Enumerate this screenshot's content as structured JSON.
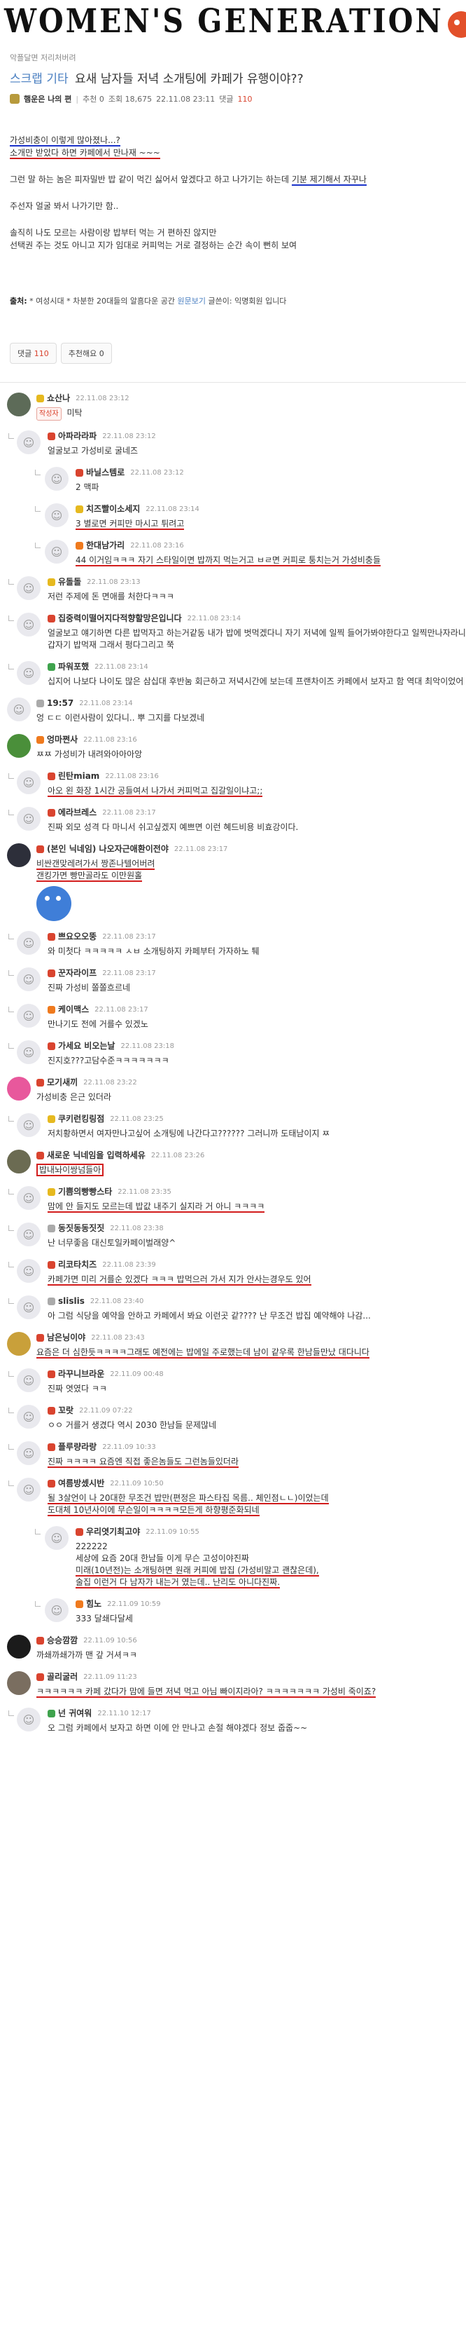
{
  "banner": {
    "title": "WOMEN'S GENERATION"
  },
  "post": {
    "board_path": "악플달면 저리처버려",
    "category": "스크랩 기타",
    "title": "요새 남자들 저녁 소개팅에 카페가 유행이야??",
    "author": "햄운은 나의 편",
    "recommend": "추천 0",
    "views": "조회 18,675",
    "datetime": "22.11.08 23:11",
    "comments_label": "댓글",
    "comments_count": "110",
    "body": {
      "line1": "가성비충이 이렇게 많아졌나...?",
      "line2": "소개만 받았다 하면 카페에서 만나재 ~~~",
      "line3a": "그런 말 하는 놈은 피자밀반 밥 같이 먹긴 싫어서 앞겠다고 하고 나가기는 하는데",
      "line3b": "기분 제기해서 자꾸나",
      "line4": "주선자 얼굴 봐서 나가기만 함..",
      "line5": "솔직히 나도 모르는 사람이랑 밥부터 먹는 거 편하진 않지만",
      "line6": "선택권 주는 것도 아니고 지가 임대로 커피먹는 거로 결정하는 순간 속이 뻔히 보여"
    },
    "source_label": "출처:",
    "source_text": "* 여성시대 * 차분한 20대들의 알흠다운 공간",
    "source_link": "원문보기",
    "source_writer": "글쓴이: 익명회원 입니다",
    "btn_comments": "댓글",
    "btn_comments_count": "110",
    "btn_recommend": "추천해요",
    "btn_recommend_count": "0"
  },
  "comments": [
    {
      "nick": "쇼산나",
      "time": "22.11.08 23:12",
      "badge": "작성자",
      "text": "미탁"
    },
    {
      "nick": "아파라라파",
      "time": "22.11.08 23:12",
      "text": "얼굴보고 가성비로 굴네즈"
    },
    {
      "nick": "바닐스템로",
      "time": "22.11.08 23:12",
      "text": "2 맥파"
    },
    {
      "nick": "치즈빨이소세지",
      "time": "22.11.08 23:14",
      "text": "3 별로면 커피만 마시고 튀려고"
    },
    {
      "nick": "한대남가리",
      "time": "22.11.08 23:16",
      "text": "44 이거임ㅋㅋㅋ 자기 스타일이면 밥까지 먹는거고 ㅂㄹ면 커피로 퉁치는거 가성비충들"
    },
    {
      "nick": "유돌돌",
      "time": "22.11.08 23:13",
      "text": "저런 주제에 돈 면애를 처한다ㅋㅋㅋ"
    },
    {
      "nick": "집중력이떨어지다적향할망은입니다",
      "time": "22.11.08 23:14",
      "text": "얼굴보고 얘기하면 다른 밥먹자고 하는거같동 내가 밥에 벗먹겠다니 자기 저녁에 일찍 들어가봐야한다고 일찍만나자라니 갑자기 밥먹재 그래서 펑다그리고 쭉"
    },
    {
      "nick": "파워포했",
      "time": "22.11.08 23:14",
      "text": "십지어 나보다 나이도 많은 삼십대 후반눔 회근하고 저녁시간에 보는데 프랜차이즈 카페에서 보자고 함 역대 최악이었어"
    },
    {
      "nick": "19:57",
      "time": "22.11.08 23:14",
      "text": "엉 ㄷㄷ 이런사람이 있다니.. 뿌 그지를 다보겠네"
    },
    {
      "nick": "엉마쩐사",
      "time": "22.11.08 23:16",
      "text": "ㅉㅉ 가성비가 내려와아아아앙"
    },
    {
      "nick": "린탄miam",
      "time": "22.11.08 23:16",
      "text": "아오 왼 화장 1시간 공들여서 나가서 커피먹고 집갈일이냐고;;"
    },
    {
      "nick": "에라브레스",
      "time": "22.11.08 23:17",
      "text": "진짜 외모 성격 다 마니서 쉬고싶겠지 예쁘면 이런 혜드비용 비효강이다."
    },
    {
      "nick": "(본인 닉네임) 나오자근애환이전야",
      "time": "22.11.08 23:17",
      "text": "비싼갠맞레려가서 짱존나텔어버려",
      "text2": "갠킹가면 빵만골라도 이만원홀"
    },
    {
      "nick": "쁘요오오뚱",
      "time": "22.11.08 23:17",
      "text": "와 미첫다 ㅋㅋㅋㅋㅋ ㅅㅂ 소개팅하지 카페부터 가자하노 퉤"
    },
    {
      "nick": "꾼자라이프",
      "time": "22.11.08 23:17",
      "text": "진짜 가성비 쫄쫄흐르네"
    },
    {
      "nick": "케이맥스",
      "time": "22.11.08 23:17",
      "text": "만나기도 전에 거를수 있겠노"
    },
    {
      "nick": "가세요 비오는날",
      "time": "22.11.08 23:18",
      "text": "진지호???고담수준ㅋㅋㅋㅋㅋㅋㅋ"
    },
    {
      "nick": "모기새끼",
      "time": "22.11.08 23:22",
      "text": "가성비충 은근 있더라"
    },
    {
      "nick": "쿠키런킹링점",
      "time": "22.11.08 23:25",
      "text": "저치황하면서 여자만나고싶어 소개팅에 나간다고?????? 그러니까 도태남이지 ㅉ"
    },
    {
      "nick": "새로운 닉네임을 입력하세유",
      "time": "22.11.08 23:26",
      "text": "밥내놔이쌍넘들아"
    },
    {
      "nick": "기쁨의빵빵스타",
      "time": "22.11.08 23:35",
      "text": "맘에 안 들지도 모르는데 밥값 내주기 실지라 거 아니 ㅋㅋㅋㅋ"
    },
    {
      "nick": "동짓동동짓짓",
      "time": "22.11.08 23:38",
      "text": "난 너무좋음 대신토일카페이벌래양^"
    },
    {
      "nick": "리코타치즈",
      "time": "22.11.08 23:39",
      "text": "카페가면 미리 거를순 있겠다 ㅋㅋㅋ 밥먹으러 가서 지가 안사는경우도 있어"
    },
    {
      "nick": "slislis",
      "time": "22.11.08 23:40",
      "text": "아 그럼 식당을 예약을 안하고 카페에서 봐요 이런곳 같???? 난 무조건 밥집 예약해야 나감..."
    },
    {
      "nick": "남은닝이야",
      "time": "22.11.08 23:43",
      "text": "요즘은 더 심한듯ㅋㅋㅋㅋ그래도 예전에는 밥에일 주로했는데 남이 같우록 한남들만났 대다니다"
    },
    {
      "nick": "라꾸니브라운",
      "time": "22.11.09 00:48",
      "text": "진짜 엿였다 ㅋㅋ"
    },
    {
      "nick": "꼬랏",
      "time": "22.11.09 07:22",
      "text": "ㅇㅇ 거를거 생겼다 역시 2030 한남들 문제많네"
    },
    {
      "nick": "플루량라랑",
      "time": "22.11.09 10:33",
      "text": "진짜 ㅋㅋㅋㅋ 요즘엔 직접 좋은놈들도 그런놈들있더라"
    },
    {
      "nick": "여름방셌시반",
      "time": "22.11.09 10:50",
      "text": "될 3살언이 나 20대한 무조건 밥만(편정은 파스타집 목름.. 체인점ㄴㄴ)이었는데",
      "text2": "도대체 10년사이에 무슨일이ㅋㅋㅋㅋ모든게 하향평준화되네"
    },
    {
      "nick": "우리엿기최고야",
      "time": "22.11.09 10:55",
      "text": "222222",
      "text2": "세상에 요즘 20대 한남들 이게 무슨 고성이야진짜",
      "text3": "미래(10년전)는 소개팅하면 원래 커피에 밥집 (가성비말고 괜찮은데),",
      "text4": "술집 이런거 다 남자가 내는거 였는데.. 난리도 아니다진짜."
    },
    {
      "nick": "힘노",
      "time": "22.11.09 10:59",
      "text": "333 달쇄다달세"
    },
    {
      "nick": "승승깜깜",
      "time": "22.11.09 10:56",
      "text": "까쇄까쇄가까 맨 갚 거셔ㅋㅋ"
    },
    {
      "nick": "골리굴러",
      "time": "22.11.09 11:23",
      "text": "ㅋㅋㅋㅋㅋㅋ 카페 갔다가 맘에 들면 저녁 먹고 아님 빠이지라아? ㅋㅋㅋㅋㅋㅋㅋ 가성비 죽이죠?"
    },
    {
      "nick": "넌 귀여워",
      "time": "22.11.10 12:17",
      "text": "오 그럼 카페에서 보자고 하면 이에 안 만나고 손절 해야겠다 정보 줍줍~~"
    }
  ]
}
